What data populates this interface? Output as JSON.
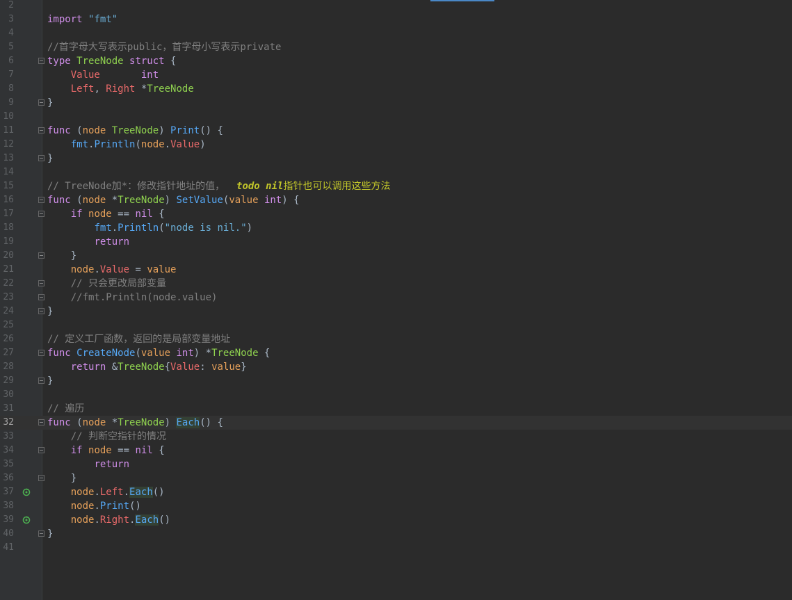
{
  "editor": {
    "current_line": 32,
    "lines": [
      {
        "n": "2",
        "t": []
      },
      {
        "n": "3",
        "t": [
          [
            "k",
            "import "
          ],
          [
            "str",
            "\"fmt\""
          ]
        ]
      },
      {
        "n": "4",
        "t": []
      },
      {
        "n": "5",
        "t": [
          [
            "com",
            "//首字母大写表示public，首字母小写表示private"
          ]
        ]
      },
      {
        "n": "6",
        "t": [
          [
            "k",
            "type "
          ],
          [
            "ty",
            "TreeNode "
          ],
          [
            "k",
            "struct "
          ],
          [
            "dflt",
            "{"
          ]
        ]
      },
      {
        "n": "7",
        "t": [
          [
            "dflt",
            "    "
          ],
          [
            "fld",
            "Value       "
          ],
          [
            "k",
            "int"
          ]
        ]
      },
      {
        "n": "8",
        "t": [
          [
            "dflt",
            "    "
          ],
          [
            "fld",
            "Left"
          ],
          [
            "dflt",
            ", "
          ],
          [
            "fld",
            "Right "
          ],
          [
            "dflt",
            "*"
          ],
          [
            "ty",
            "TreeNode"
          ]
        ]
      },
      {
        "n": "9",
        "t": [
          [
            "dflt",
            "}"
          ]
        ]
      },
      {
        "n": "10",
        "t": []
      },
      {
        "n": "11",
        "t": [
          [
            "k",
            "func "
          ],
          [
            "dflt",
            "("
          ],
          [
            "par",
            "node "
          ],
          [
            "ty",
            "TreeNode"
          ],
          [
            "dflt",
            ") "
          ],
          [
            "fn",
            "Print"
          ],
          [
            "dflt",
            "() {"
          ]
        ]
      },
      {
        "n": "12",
        "t": [
          [
            "dflt",
            "    "
          ],
          [
            "pkg",
            "fmt"
          ],
          [
            "dflt",
            "."
          ],
          [
            "fn",
            "Println"
          ],
          [
            "dflt",
            "("
          ],
          [
            "par",
            "node"
          ],
          [
            "dflt",
            "."
          ],
          [
            "fld",
            "Value"
          ],
          [
            "dflt",
            ")"
          ]
        ]
      },
      {
        "n": "13",
        "t": [
          [
            "dflt",
            "}"
          ]
        ]
      },
      {
        "n": "14",
        "t": []
      },
      {
        "n": "15",
        "t": [
          [
            "com",
            "// TreeNode加*：修改指针地址的值，  "
          ],
          [
            "todo",
            "todo nil"
          ],
          [
            "todot",
            "指针也可以调用这些方法"
          ]
        ]
      },
      {
        "n": "16",
        "t": [
          [
            "k",
            "func "
          ],
          [
            "dflt",
            "("
          ],
          [
            "par",
            "node "
          ],
          [
            "dflt",
            "*"
          ],
          [
            "ty",
            "TreeNode"
          ],
          [
            "dflt",
            ") "
          ],
          [
            "fn",
            "SetValue"
          ],
          [
            "dflt",
            "("
          ],
          [
            "par",
            "value "
          ],
          [
            "k",
            "int"
          ],
          [
            "dflt",
            ") {"
          ]
        ]
      },
      {
        "n": "17",
        "t": [
          [
            "dflt",
            "    "
          ],
          [
            "k",
            "if "
          ],
          [
            "par",
            "node "
          ],
          [
            "dflt",
            "== "
          ],
          [
            "k",
            "nil "
          ],
          [
            "dflt",
            "{"
          ]
        ]
      },
      {
        "n": "18",
        "t": [
          [
            "dflt",
            "        "
          ],
          [
            "pkg",
            "fmt"
          ],
          [
            "dflt",
            "."
          ],
          [
            "fn",
            "Println"
          ],
          [
            "dflt",
            "("
          ],
          [
            "str",
            "\"node is nil.\""
          ],
          [
            "dflt",
            ")"
          ]
        ]
      },
      {
        "n": "19",
        "t": [
          [
            "dflt",
            "        "
          ],
          [
            "k",
            "return"
          ]
        ]
      },
      {
        "n": "20",
        "t": [
          [
            "dflt",
            "    }"
          ]
        ]
      },
      {
        "n": "21",
        "t": [
          [
            "dflt",
            "    "
          ],
          [
            "par",
            "node"
          ],
          [
            "dflt",
            "."
          ],
          [
            "fld",
            "Value "
          ],
          [
            "dflt",
            "= "
          ],
          [
            "par",
            "value"
          ]
        ]
      },
      {
        "n": "22",
        "t": [
          [
            "dflt",
            "    "
          ],
          [
            "com",
            "// 只会更改局部变量"
          ]
        ]
      },
      {
        "n": "23",
        "t": [
          [
            "dflt",
            "    "
          ],
          [
            "com",
            "//fmt.Println(node.value)"
          ]
        ]
      },
      {
        "n": "24",
        "t": [
          [
            "dflt",
            "}"
          ]
        ]
      },
      {
        "n": "25",
        "t": []
      },
      {
        "n": "26",
        "t": [
          [
            "com",
            "// 定义工厂函数，返回的是局部变量地址"
          ]
        ]
      },
      {
        "n": "27",
        "t": [
          [
            "k",
            "func "
          ],
          [
            "fn",
            "CreateNode"
          ],
          [
            "dflt",
            "("
          ],
          [
            "par",
            "value "
          ],
          [
            "k",
            "int"
          ],
          [
            "dflt",
            ") *"
          ],
          [
            "ty",
            "TreeNode "
          ],
          [
            "dflt",
            "{"
          ]
        ]
      },
      {
        "n": "28",
        "t": [
          [
            "dflt",
            "    "
          ],
          [
            "k",
            "return "
          ],
          [
            "dflt",
            "&"
          ],
          [
            "ty",
            "TreeNode"
          ],
          [
            "dflt",
            "{"
          ],
          [
            "fld",
            "Value"
          ],
          [
            "dflt",
            ": "
          ],
          [
            "par",
            "value"
          ],
          [
            "dflt",
            "}"
          ]
        ]
      },
      {
        "n": "29",
        "t": [
          [
            "dflt",
            "}"
          ]
        ]
      },
      {
        "n": "30",
        "t": []
      },
      {
        "n": "31",
        "t": [
          [
            "com",
            "// 遍历"
          ]
        ]
      },
      {
        "n": "32",
        "t": [
          [
            "k",
            "func "
          ],
          [
            "dflt",
            "("
          ],
          [
            "par",
            "node "
          ],
          [
            "dflt",
            "*"
          ],
          [
            "ty",
            "TreeNode"
          ],
          [
            "dflt",
            ") "
          ],
          [
            "caret",
            ""
          ],
          [
            "fnhl",
            "Each"
          ],
          [
            "dflt",
            "() {"
          ]
        ]
      },
      {
        "n": "33",
        "t": [
          [
            "dflt",
            "    "
          ],
          [
            "com",
            "// 判断空指针的情况"
          ]
        ]
      },
      {
        "n": "34",
        "t": [
          [
            "dflt",
            "    "
          ],
          [
            "k",
            "if "
          ],
          [
            "par",
            "node "
          ],
          [
            "dflt",
            "== "
          ],
          [
            "k",
            "nil "
          ],
          [
            "dflt",
            "{"
          ]
        ]
      },
      {
        "n": "35",
        "t": [
          [
            "dflt",
            "        "
          ],
          [
            "k",
            "return"
          ]
        ]
      },
      {
        "n": "36",
        "t": [
          [
            "dflt",
            "    }"
          ]
        ]
      },
      {
        "n": "37",
        "t": [
          [
            "dflt",
            "    "
          ],
          [
            "par",
            "node"
          ],
          [
            "dflt",
            "."
          ],
          [
            "fld",
            "Left"
          ],
          [
            "dflt",
            "."
          ],
          [
            "fnhl",
            "Each"
          ],
          [
            "dflt",
            "()"
          ]
        ]
      },
      {
        "n": "38",
        "t": [
          [
            "dflt",
            "    "
          ],
          [
            "par",
            "node"
          ],
          [
            "dflt",
            "."
          ],
          [
            "fn",
            "Print"
          ],
          [
            "dflt",
            "()"
          ]
        ]
      },
      {
        "n": "39",
        "t": [
          [
            "dflt",
            "    "
          ],
          [
            "par",
            "node"
          ],
          [
            "dflt",
            "."
          ],
          [
            "fld",
            "Right"
          ],
          [
            "dflt",
            "."
          ],
          [
            "fnhl",
            "Each"
          ],
          [
            "dflt",
            "()"
          ]
        ]
      },
      {
        "n": "40",
        "t": [
          [
            "dflt",
            "}"
          ]
        ]
      },
      {
        "n": "41",
        "t": []
      }
    ],
    "fold_lines": [
      "6",
      "9",
      "11",
      "13",
      "16",
      "17",
      "20",
      "22",
      "23",
      "24",
      "27",
      "29",
      "32",
      "34",
      "36",
      "40"
    ],
    "recursion_icon_lines": [
      "37",
      "39"
    ]
  }
}
